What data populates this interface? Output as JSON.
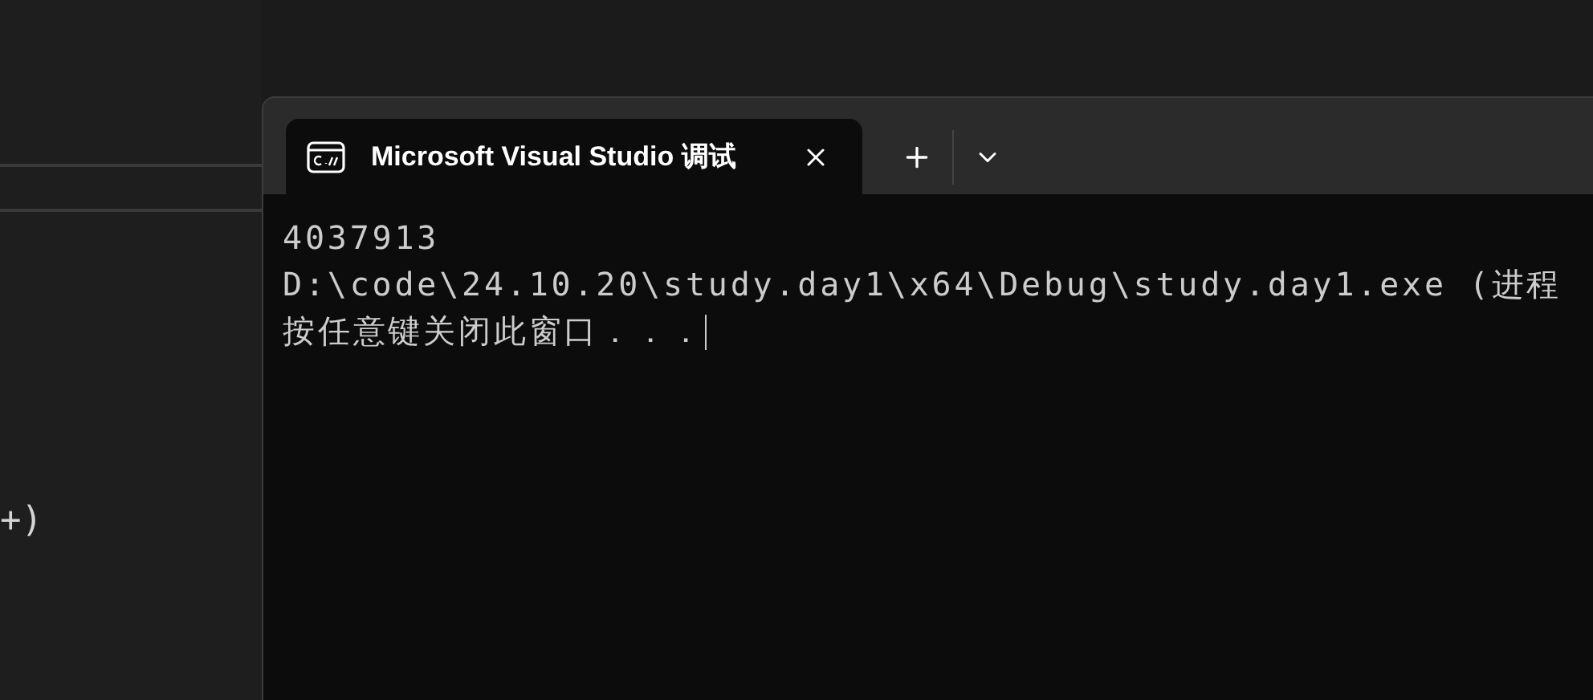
{
  "editor": {
    "code_fragment": "+)"
  },
  "terminal": {
    "tab": {
      "title": "Microsoft Visual Studio 调试",
      "selected": true
    },
    "lines": [
      "4037913",
      "D:\\code\\24.10.20\\study.day1\\x64\\Debug\\study.day1.exe (进程",
      "按任意键关闭此窗口．．．"
    ]
  }
}
